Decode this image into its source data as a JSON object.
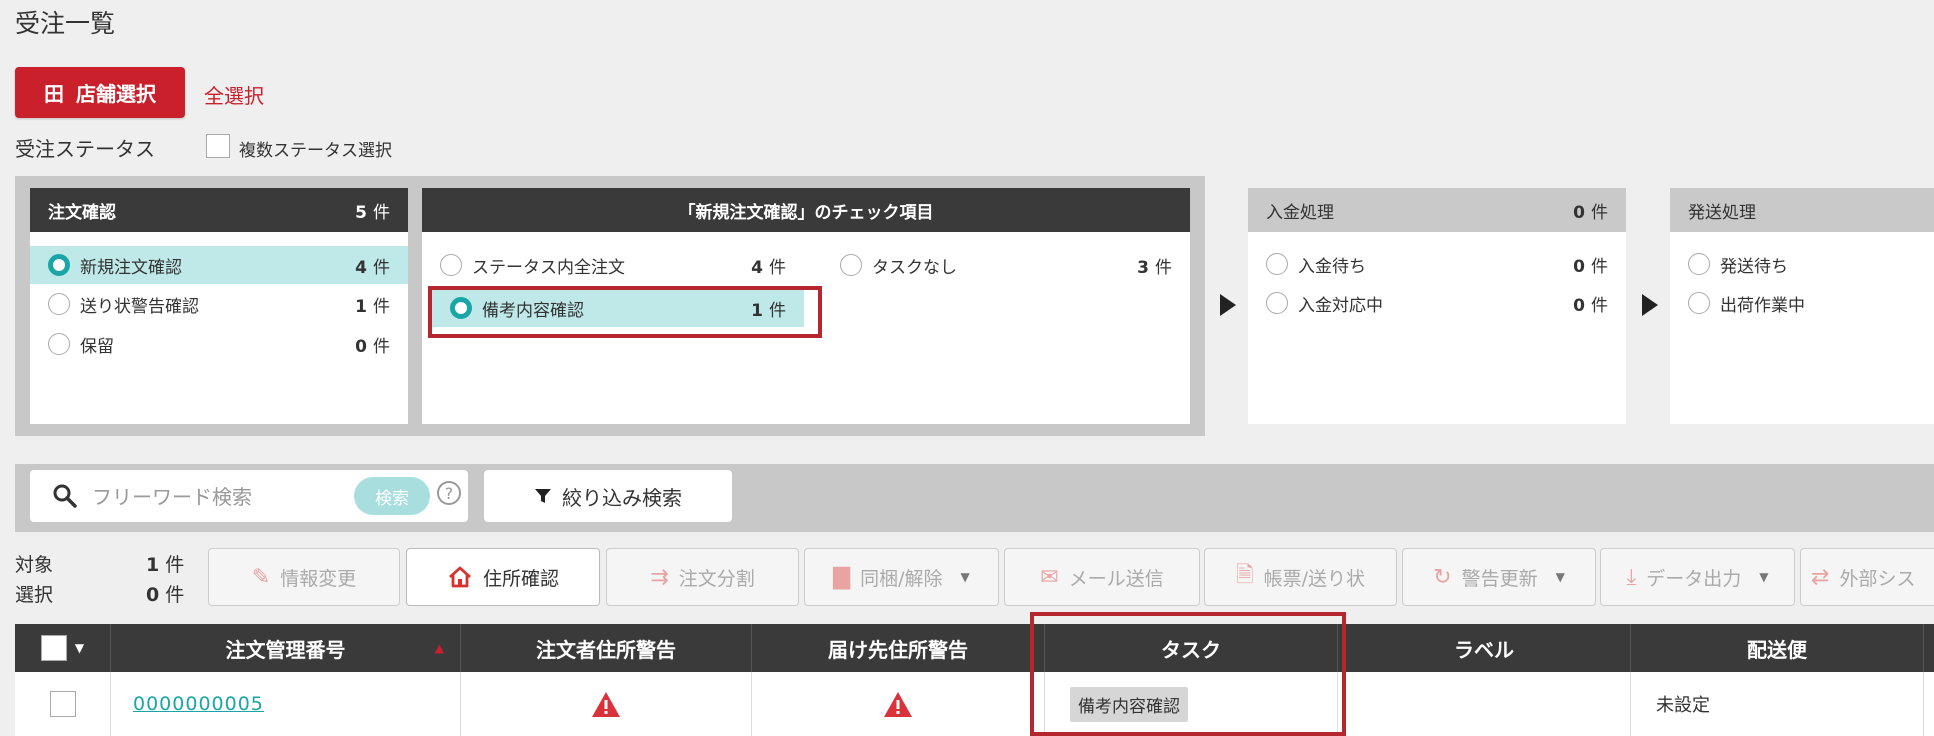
{
  "page": {
    "title": "受注一覧"
  },
  "store": {
    "button_label": "店舗選択",
    "select_all": "全選択"
  },
  "status": {
    "label": "受注ステータス",
    "multi_select_label": "複数ステータス選択"
  },
  "groups": [
    {
      "title": "注文確認",
      "count": "5",
      "unit": "件",
      "items": [
        {
          "label": "新規注文確認",
          "count": "4",
          "unit": "件",
          "selected": true
        },
        {
          "label": "送り状警告確認",
          "count": "1",
          "unit": "件",
          "selected": false
        },
        {
          "label": "保留",
          "count": "0",
          "unit": "件",
          "selected": false
        }
      ]
    },
    {
      "title": "入金処理",
      "count": "0",
      "unit": "件",
      "items": [
        {
          "label": "入金待ち",
          "count": "0",
          "unit": "件"
        },
        {
          "label": "入金対応中",
          "count": "0",
          "unit": "件"
        }
      ]
    },
    {
      "title": "発送処理",
      "items": [
        {
          "label": "発送待ち"
        },
        {
          "label": "出荷作業中"
        }
      ]
    }
  ],
  "check_panel": {
    "title": "「新規注文確認」のチェック項目",
    "items": [
      {
        "label": "ステータス内全注文",
        "count": "4",
        "unit": "件",
        "selected": false
      },
      {
        "label": "タスクなし",
        "count": "3",
        "unit": "件",
        "selected": false
      },
      {
        "label": "備考内容確認",
        "count": "1",
        "unit": "件",
        "selected": true
      }
    ]
  },
  "search": {
    "placeholder": "フリーワード検索",
    "button": "検索",
    "help": "?",
    "filter_button": "絞り込み検索"
  },
  "summary": {
    "target_label": "対象",
    "target_count": "1",
    "selected_label": "選択",
    "selected_count": "0",
    "unit": "件"
  },
  "toolbar": [
    {
      "label": "情報変更",
      "icon": "pencil-icon"
    },
    {
      "label": "住所確認",
      "icon": "house-icon",
      "active": true
    },
    {
      "label": "注文分割",
      "icon": "split-icon"
    },
    {
      "label": "同梱/解除",
      "icon": "bundle-icon",
      "dropdown": true
    },
    {
      "label": "メール送信",
      "icon": "mail-icon"
    },
    {
      "label": "帳票/送り状",
      "icon": "document-icon"
    },
    {
      "label": "警告更新",
      "icon": "refresh-icon",
      "dropdown": true
    },
    {
      "label": "データ出力",
      "icon": "download-icon",
      "dropdown": true
    },
    {
      "label": "外部シス",
      "icon": "transfer-icon"
    }
  ],
  "table": {
    "columns": [
      "注文管理番号",
      "注文者住所警告",
      "届け先住所警告",
      "タスク",
      "ラベル",
      "配送便"
    ],
    "rows": [
      {
        "order_no": "0000000005",
        "task": "備考内容確認",
        "delivery": "未設定"
      }
    ]
  },
  "colors": {
    "accent_red": "#c9202c",
    "teal": "#1aa6a6",
    "selected_bg": "#bfe8e8",
    "header_dark": "#3a3a3a"
  }
}
